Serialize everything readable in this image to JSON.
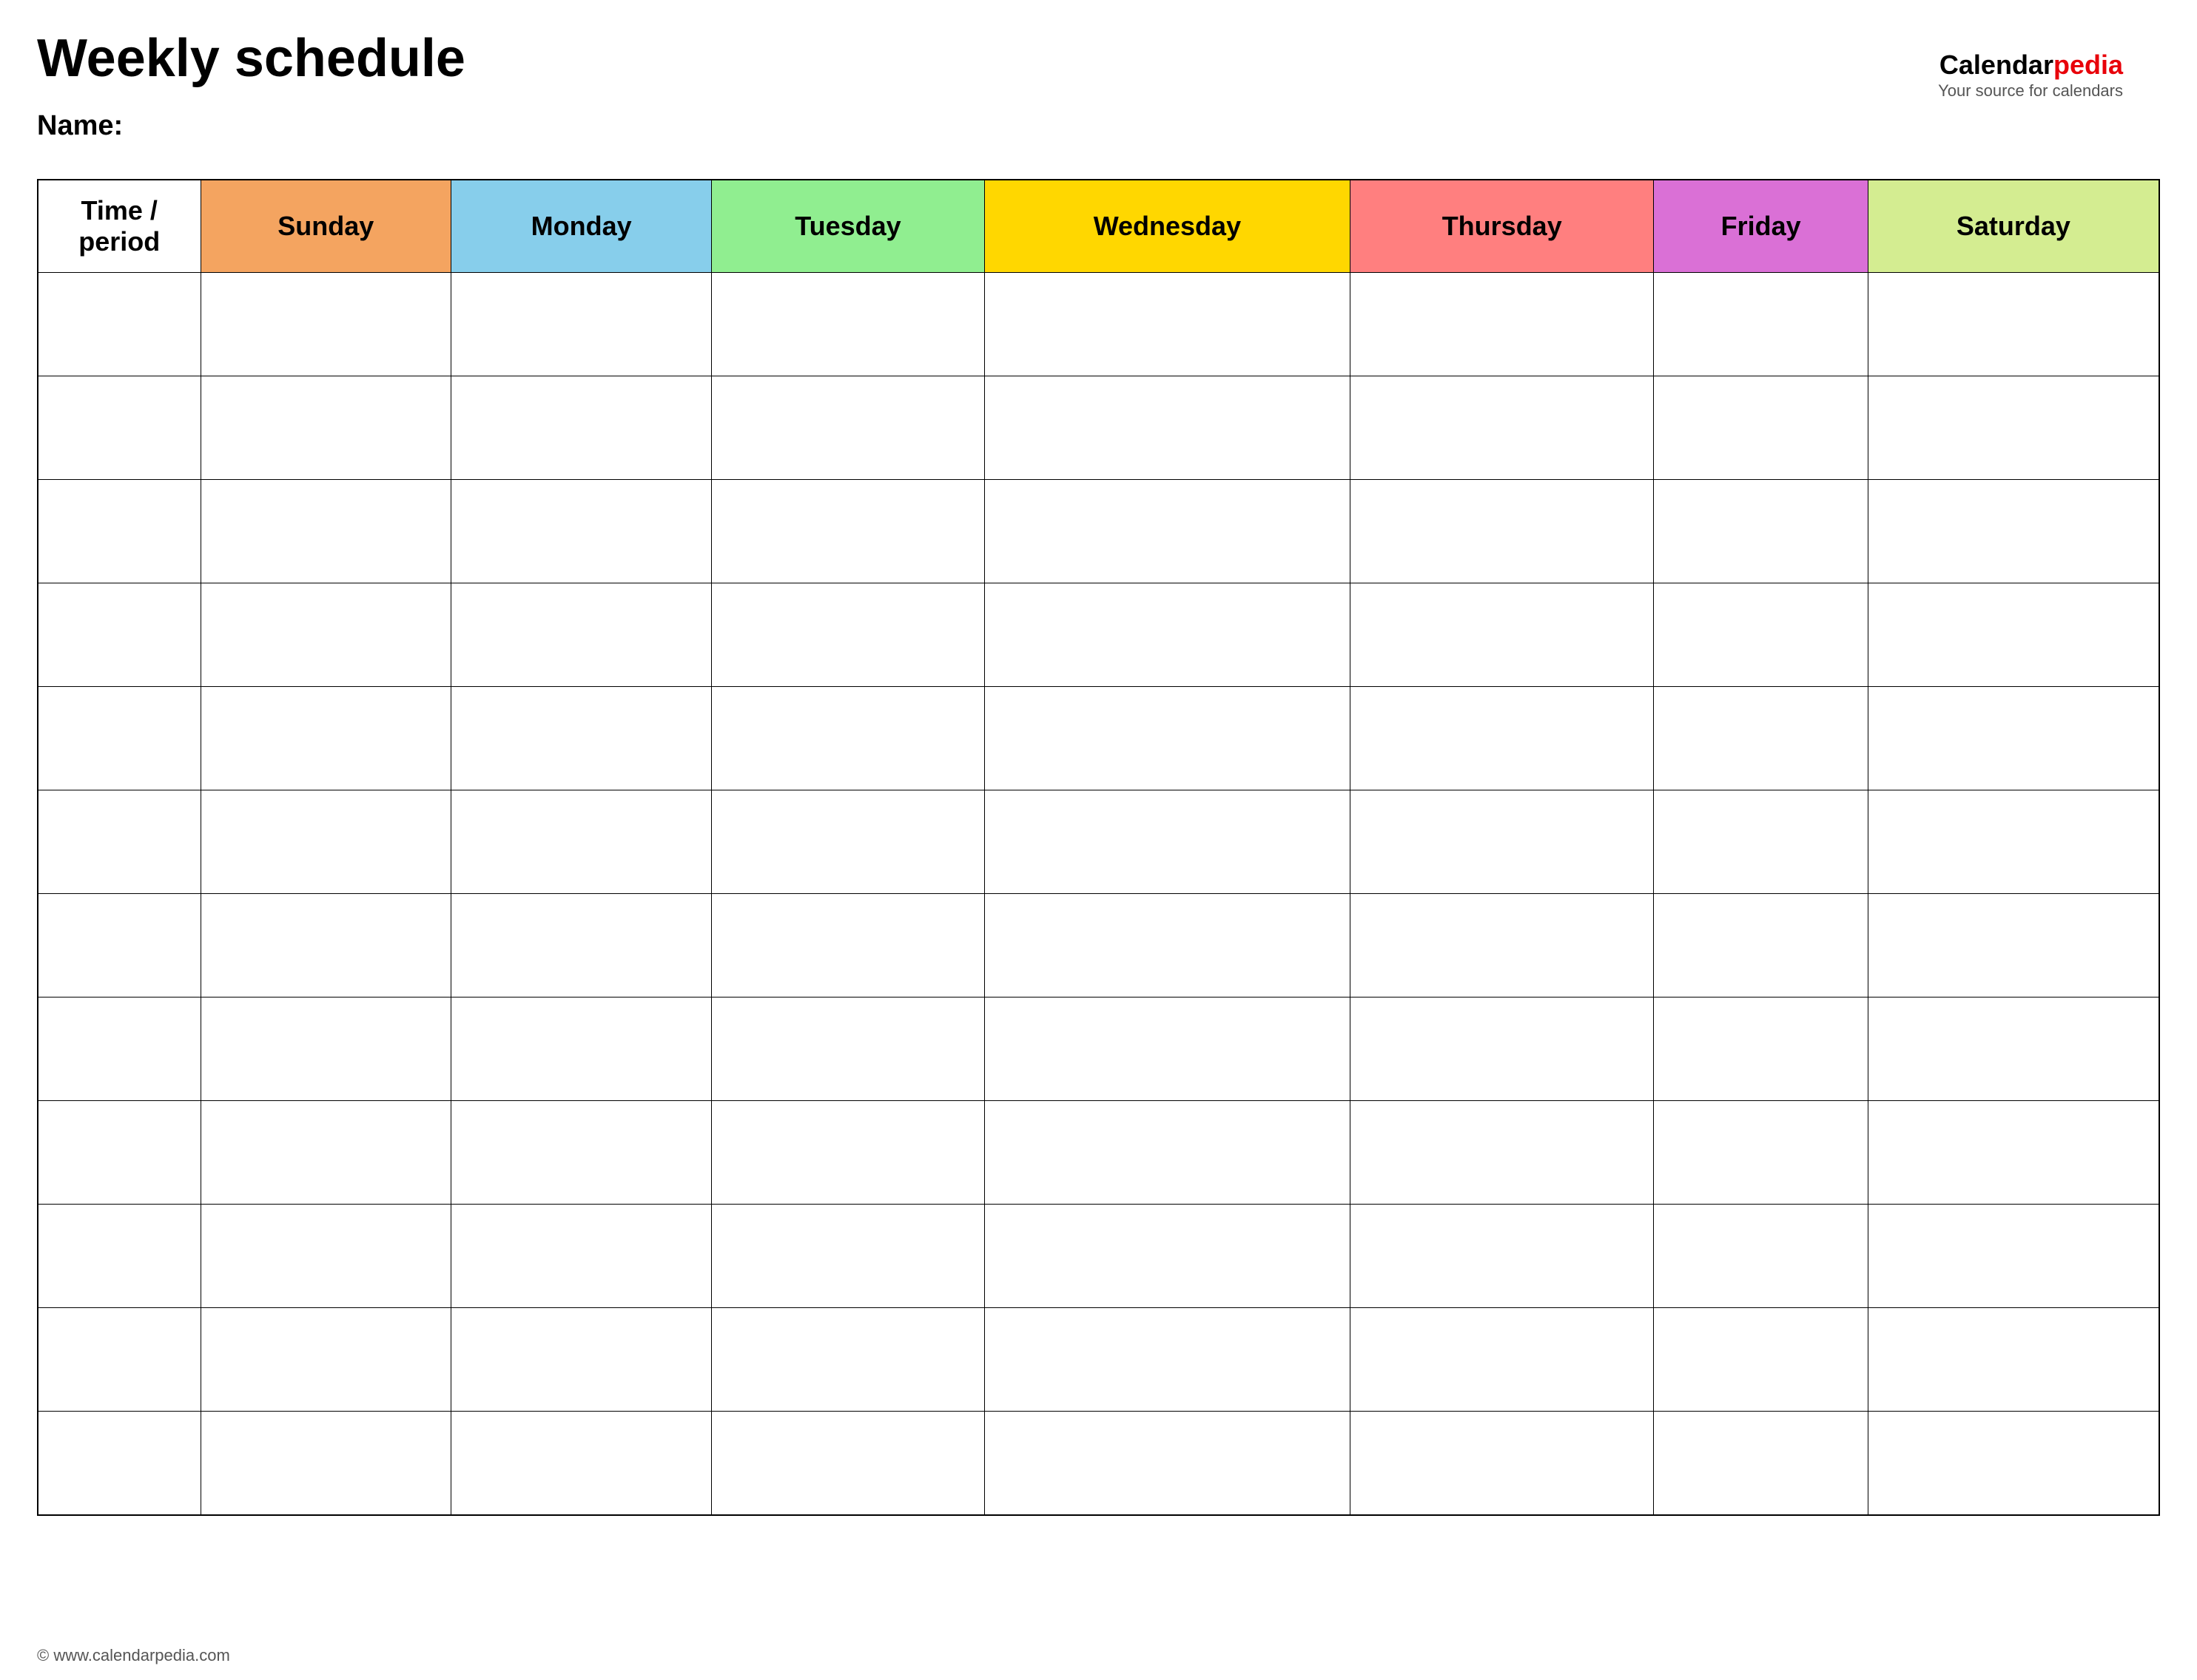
{
  "page": {
    "title": "Weekly schedule",
    "name_label": "Name:",
    "footer_text": "© www.calendarpedia.com"
  },
  "logo": {
    "brand_part1": "Calendar",
    "brand_part2": "pedia",
    "tagline": "Your source for calendars"
  },
  "table": {
    "header": {
      "time_label": "Time / period",
      "days": [
        {
          "label": "Sunday",
          "color": "#f4a460"
        },
        {
          "label": "Monday",
          "color": "#87ceeb"
        },
        {
          "label": "Tuesday",
          "color": "#90ee90"
        },
        {
          "label": "Wednesday",
          "color": "#ffd700"
        },
        {
          "label": "Thursday",
          "color": "#ff7f7f"
        },
        {
          "label": "Friday",
          "color": "#da70d6"
        },
        {
          "label": "Saturday",
          "color": "#d4ed91"
        }
      ]
    },
    "row_count": 12
  }
}
